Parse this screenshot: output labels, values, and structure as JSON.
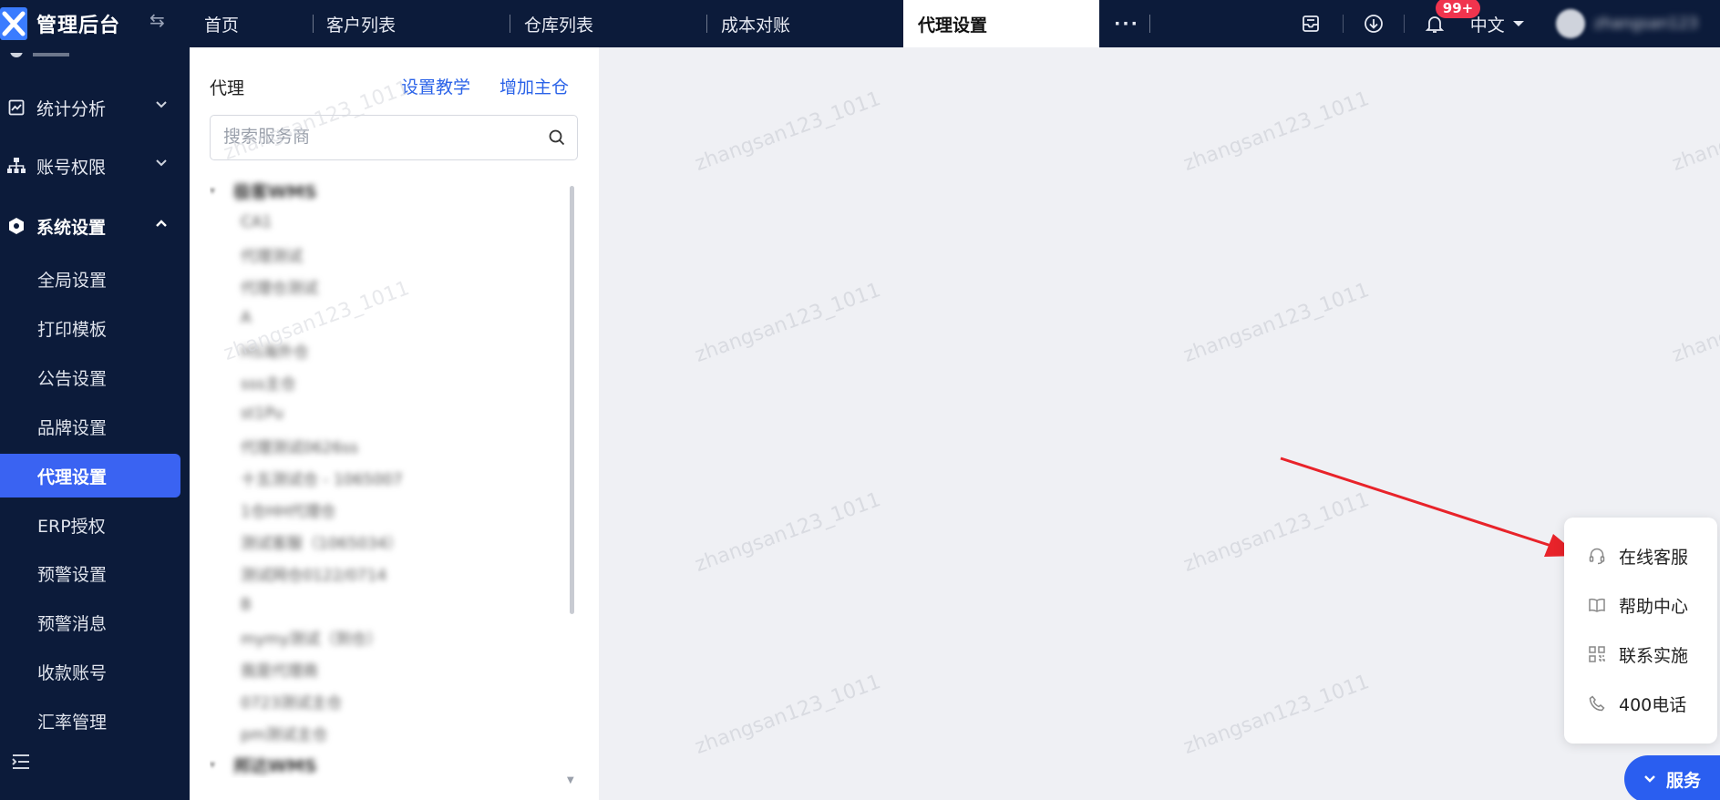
{
  "app": {
    "title": "管理后台"
  },
  "tabs": [
    {
      "label": "首页"
    },
    {
      "label": "客户列表"
    },
    {
      "label": "仓库列表"
    },
    {
      "label": "成本对账"
    },
    {
      "label": "代理设置"
    }
  ],
  "tab_more": "···",
  "header": {
    "notification_count": "99+",
    "language": "中文",
    "username": "zhangsan123"
  },
  "sidebar": {
    "groups": [
      {
        "label": "统计分析",
        "icon": "chart-icon"
      },
      {
        "label": "账号权限",
        "icon": "org-tree-icon"
      },
      {
        "label": "系统设置",
        "icon": "settings-hex-icon"
      }
    ],
    "items": [
      {
        "label": "全局设置"
      },
      {
        "label": "打印模板"
      },
      {
        "label": "公告设置"
      },
      {
        "label": "品牌设置"
      },
      {
        "label": "代理设置"
      },
      {
        "label": "ERP授权"
      },
      {
        "label": "预警设置"
      },
      {
        "label": "预警消息"
      },
      {
        "label": "收款账号"
      },
      {
        "label": "汇率管理"
      }
    ]
  },
  "panel": {
    "title": "代理",
    "tutorial_link": "设置教学",
    "add_main_warehouse_link": "增加主仓",
    "search_placeholder": "搜索服务商",
    "tree": {
      "groups": [
        {
          "label": "极客WMS"
        },
        {
          "label": "邦达WMS"
        }
      ],
      "items": [
        {
          "label": "CA1"
        },
        {
          "label": "代理测试"
        },
        {
          "label": "代理仓测试"
        },
        {
          "label": "A"
        },
        {
          "label": "HS海外仓"
        },
        {
          "label": "sss主仓"
        },
        {
          "label": "st1Pu"
        },
        {
          "label": "代理测试0626ss"
        },
        {
          "label": "十五测试仓 - 1065007"
        },
        {
          "label": "1仓HH代理仓"
        },
        {
          "label": "测试客服（1065034）"
        },
        {
          "label": "测试网仓0122/0714"
        },
        {
          "label": "B"
        },
        {
          "label": "mymy测试（到仓）"
        },
        {
          "label": "我是代理商"
        },
        {
          "label": "0723测试主仓"
        },
        {
          "label": "pm测试主仓"
        }
      ]
    }
  },
  "watermark": "zhangsan123_1011",
  "service_menu": {
    "items": [
      {
        "label": "在线客服",
        "icon": "headset-icon"
      },
      {
        "label": "帮助中心",
        "icon": "book-icon"
      },
      {
        "label": "联系实施",
        "icon": "qrcode-icon"
      },
      {
        "label": "400电话",
        "icon": "phone-icon"
      }
    ],
    "button_label": "服务"
  },
  "colors": {
    "nav_bg": "#0c1b3a",
    "accent": "#3a63f2",
    "link": "#2b63e8",
    "badge": "#f0344e",
    "arrow": "#e8232a",
    "service_button": "#2a5ef0"
  }
}
